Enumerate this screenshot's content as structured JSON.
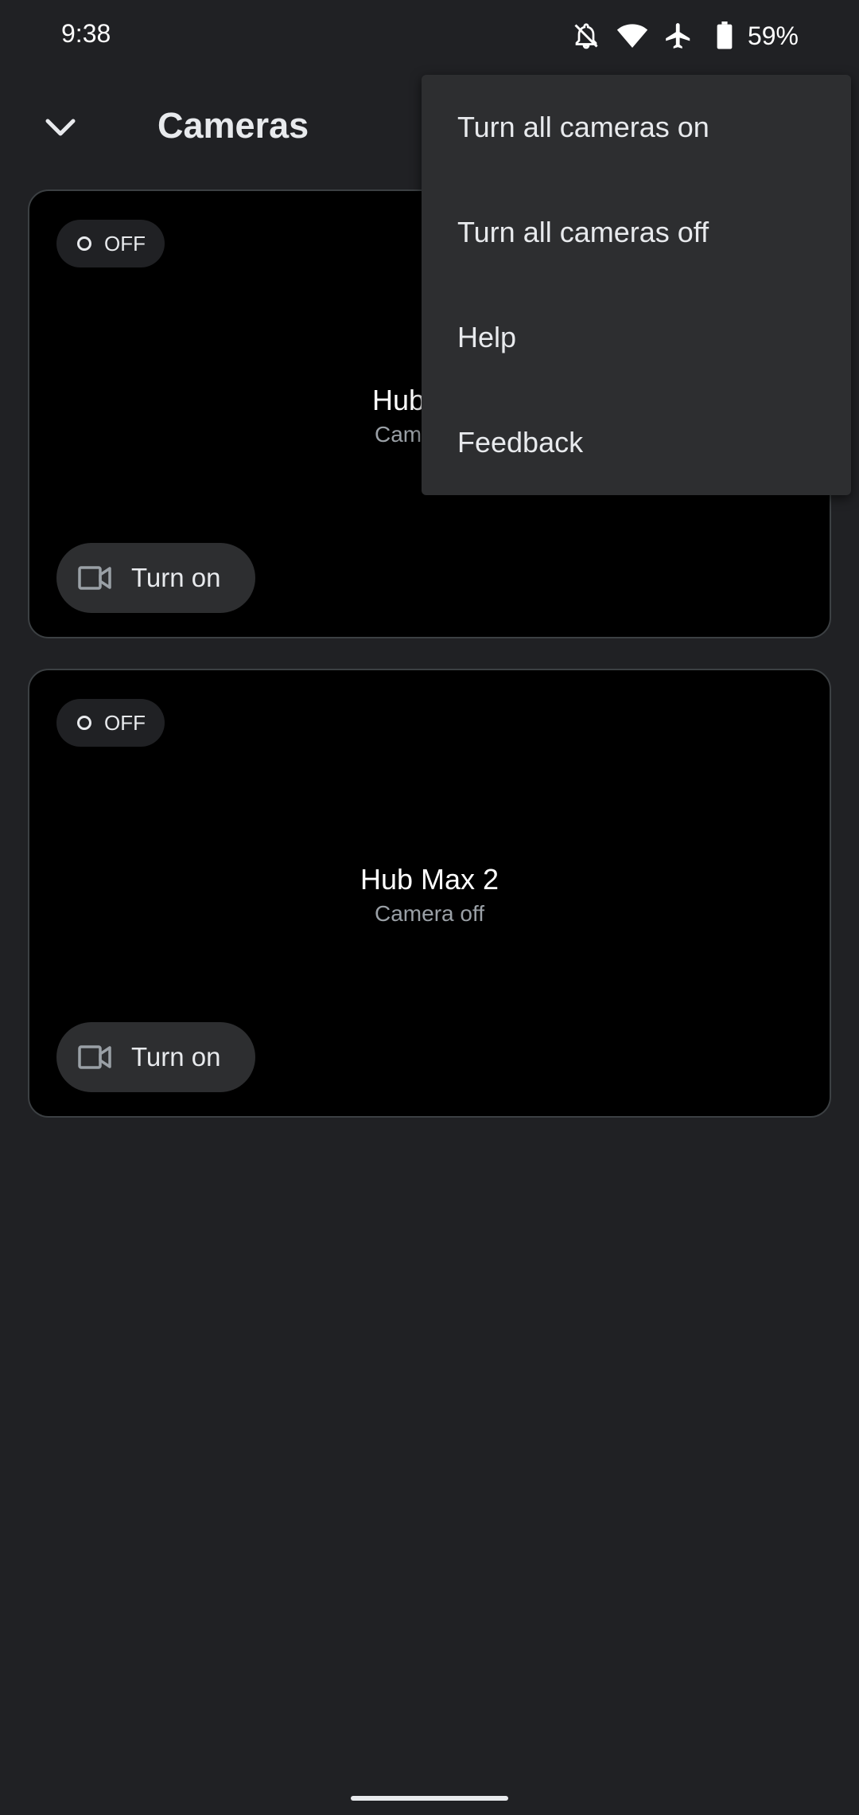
{
  "status_bar": {
    "time": "9:38",
    "battery_percent": "59%",
    "icons": [
      "notifications-off-icon",
      "wifi-icon",
      "airplane-mode-icon",
      "battery-icon"
    ]
  },
  "header": {
    "title": "Cameras",
    "collapse_icon": "chevron-down-icon"
  },
  "cameras": [
    {
      "status": "OFF",
      "name": "Hub Max",
      "subtitle": "Camera off",
      "action_label": "Turn on"
    },
    {
      "status": "OFF",
      "name": "Hub Max 2",
      "subtitle": "Camera off",
      "action_label": "Turn on"
    }
  ],
  "menu": {
    "items": [
      {
        "label": "Turn all cameras on"
      },
      {
        "label": "Turn all cameras off"
      },
      {
        "label": "Help"
      },
      {
        "label": "Feedback"
      }
    ]
  },
  "colors": {
    "background": "#202124",
    "card": "#000000",
    "menu": "#2d2e30",
    "text": "#e8eaed",
    "subtext": "#9aa0a6"
  }
}
